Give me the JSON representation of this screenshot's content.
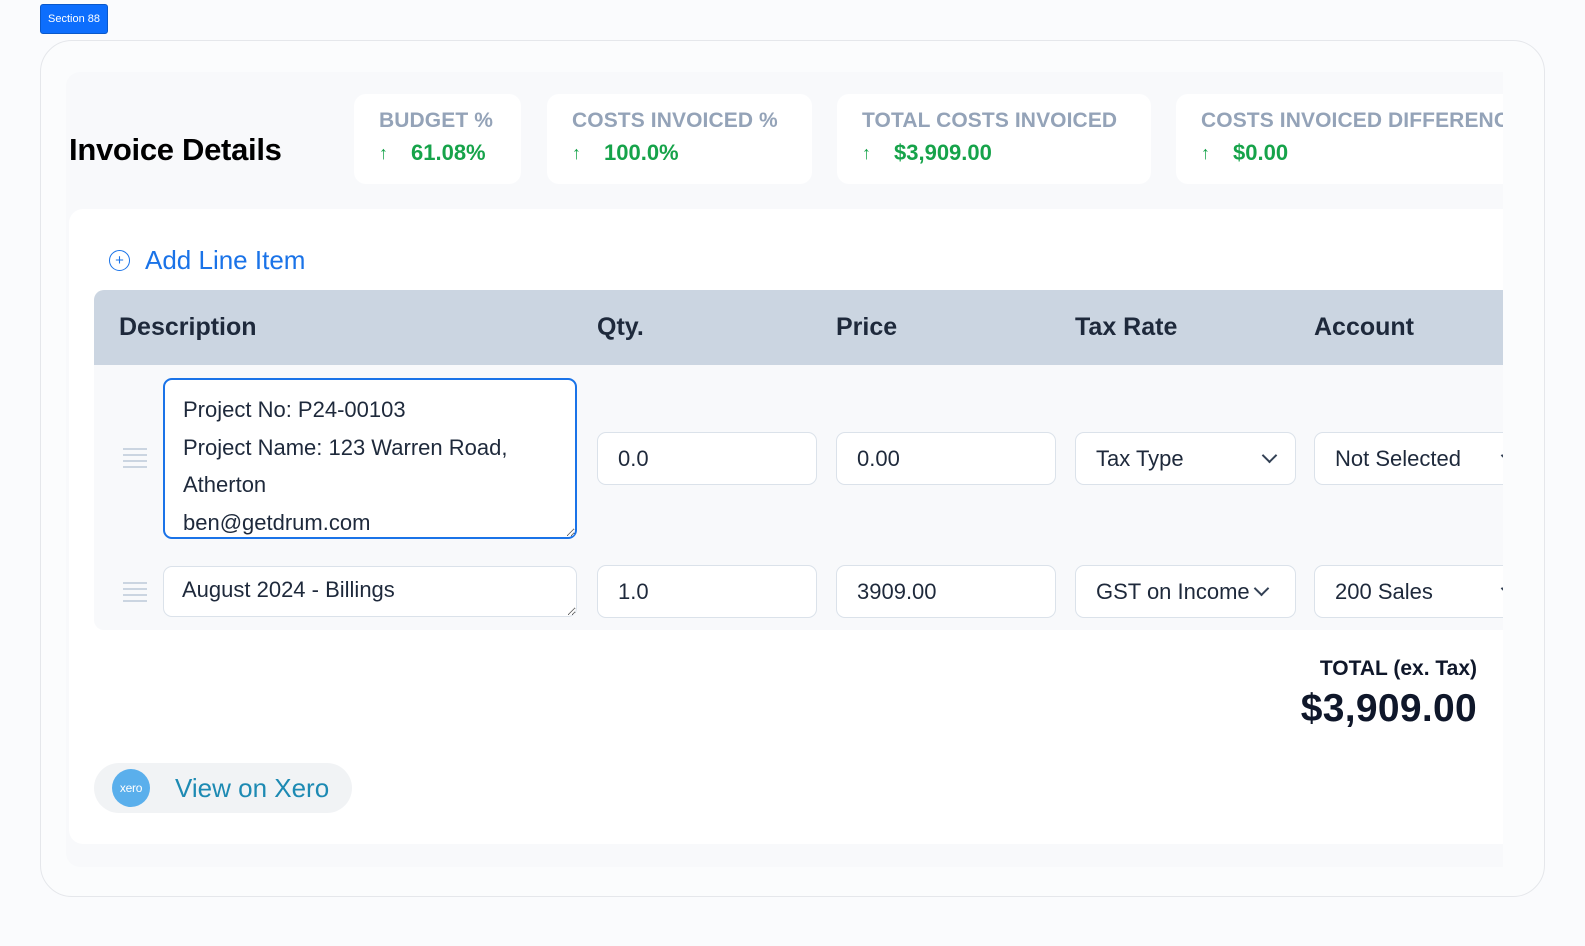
{
  "section_badge": "Section 88",
  "page_title": "Invoice Details",
  "metrics": [
    {
      "label": "BUDGET %",
      "value": "61.08%",
      "trend": "up"
    },
    {
      "label": "COSTS INVOICED %",
      "value": "100.0%",
      "trend": "up"
    },
    {
      "label": "TOTAL COSTS INVOICED",
      "value": "$3,909.00",
      "trend": "up"
    },
    {
      "label": "COSTS INVOICED DIFFERENCE",
      "value": "$0.00",
      "trend": "up"
    }
  ],
  "trend_icon": "↑",
  "add_line_item_label": "Add Line Item",
  "add_icon": "+",
  "table": {
    "columns": [
      "Description",
      "Qty.",
      "Price",
      "Tax Rate",
      "Account"
    ],
    "rows": [
      {
        "description": "Project No: P24-00103\nProject Name: 123 Warren Road, Atherton\nben@getdrum.com",
        "qty": "0.0",
        "price": "0.00",
        "tax_rate": "Tax Type",
        "account": "Not Selected"
      },
      {
        "description": "August 2024 - Billings",
        "qty": "1.0",
        "price": "3909.00",
        "tax_rate": "GST on Income",
        "account": "200 Sales"
      }
    ]
  },
  "totals": {
    "label": "TOTAL (ex. Tax)",
    "value": "$3,909.00"
  },
  "xero": {
    "logo_text": "xero",
    "label": "View on Xero"
  },
  "colors": {
    "accent": "#1a73e8",
    "positive": "#16a34a",
    "muted_label": "#94a3b8",
    "table_header_bg": "#cbd5e1",
    "xero_brand": "#5aafec",
    "badge": "#0d6efd"
  }
}
